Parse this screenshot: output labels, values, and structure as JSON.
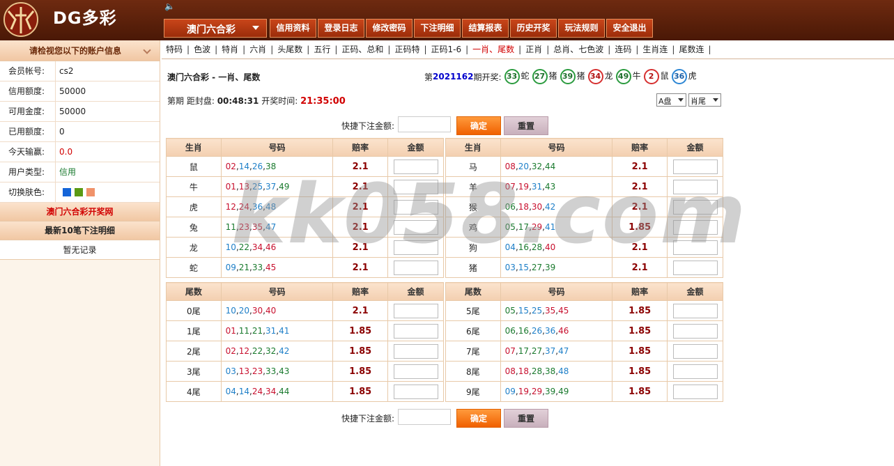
{
  "header": {
    "brand": "DG多彩",
    "game_select": "澳门六合彩",
    "nav": [
      "信用资料",
      "登录日志",
      "修改密码",
      "下注明细",
      "结算报表",
      "历史开奖",
      "玩法规则",
      "安全退出"
    ]
  },
  "sidebar": {
    "title": "请检视您以下的账户信息",
    "rows": [
      {
        "k": "会员帐号:",
        "v": "cs2"
      },
      {
        "k": "信用额度:",
        "v": "50000"
      },
      {
        "k": "可用金度:",
        "v": "50000"
      },
      {
        "k": "已用额度:",
        "v": "0"
      },
      {
        "k": "今天输赢:",
        "v": "0.0"
      },
      {
        "k": "用户类型:",
        "v": "信用"
      }
    ],
    "skin_label": "切换肤色:",
    "skin_colors": [
      "#1565d8",
      "#5b9a14",
      "#f0926a"
    ],
    "link1": "澳门六合彩开奖网",
    "link2": "最新10笔下注明细",
    "no_record": "暂无记录"
  },
  "subnav": [
    "特码",
    "色波",
    "特肖",
    "六肖",
    "头尾数",
    "五行",
    "正码、总和",
    "正码特",
    "正码1-6",
    "一肖、尾数",
    "正肖",
    "总肖、七色波",
    "连码",
    "生肖连",
    "尾数连"
  ],
  "subnav_active": "一肖、尾数",
  "main": {
    "title": "澳门六合彩 - 一肖、尾数",
    "draw_prefix": "第",
    "draw_period": "2021162",
    "draw_suffix": "期开奖:",
    "draw_balls": [
      {
        "n": "33",
        "z": "蛇",
        "c": "green"
      },
      {
        "n": "27",
        "z": "猪",
        "c": "green"
      },
      {
        "n": "39",
        "z": "猪",
        "c": "green"
      },
      {
        "n": "34",
        "z": "龙",
        "c": "red"
      },
      {
        "n": "49",
        "z": "牛",
        "c": "green"
      },
      {
        "n": "2",
        "z": "鼠",
        "c": "red"
      },
      {
        "n": "36",
        "z": "虎",
        "c": "blue"
      }
    ],
    "period_label": "第期 距封盘:",
    "countdown": "00:48:31",
    "open_label": "开奖时间:",
    "open_time": "21:35:00",
    "pan_select": "A盘",
    "type_select": "肖尾",
    "quick_label": "快捷下注金额:",
    "confirm": "确定",
    "reset": "重置"
  },
  "zodiac_headers": [
    "生肖",
    "号码",
    "赔率",
    "金额"
  ],
  "tail_headers": [
    "尾数",
    "号码",
    "赔率",
    "金额"
  ],
  "zodiac_left": [
    {
      "name": "鼠",
      "nums": [
        [
          "02",
          "r"
        ],
        [
          "14",
          "b"
        ],
        [
          "26",
          "b"
        ],
        [
          "38",
          "g"
        ]
      ],
      "odds": "2.1"
    },
    {
      "name": "牛",
      "nums": [
        [
          "01",
          "r"
        ],
        [
          "13",
          "r"
        ],
        [
          "25",
          "b"
        ],
        [
          "37",
          "b"
        ],
        [
          "49",
          "g"
        ]
      ],
      "odds": "2.1"
    },
    {
      "name": "虎",
      "nums": [
        [
          "12",
          "r"
        ],
        [
          "24",
          "r"
        ],
        [
          "36",
          "b"
        ],
        [
          "48",
          "b"
        ]
      ],
      "odds": "2.1"
    },
    {
      "name": "兔",
      "nums": [
        [
          "11",
          "g"
        ],
        [
          "23",
          "r"
        ],
        [
          "35",
          "r"
        ],
        [
          "47",
          "b"
        ]
      ],
      "odds": "2.1"
    },
    {
      "name": "龙",
      "nums": [
        [
          "10",
          "b"
        ],
        [
          "22",
          "g"
        ],
        [
          "34",
          "r"
        ],
        [
          "46",
          "r"
        ]
      ],
      "odds": "2.1"
    },
    {
      "name": "蛇",
      "nums": [
        [
          "09",
          "b"
        ],
        [
          "21",
          "g"
        ],
        [
          "33",
          "g"
        ],
        [
          "45",
          "r"
        ]
      ],
      "odds": "2.1"
    }
  ],
  "zodiac_right": [
    {
      "name": "马",
      "nums": [
        [
          "08",
          "r"
        ],
        [
          "20",
          "b"
        ],
        [
          "32",
          "g"
        ],
        [
          "44",
          "g"
        ]
      ],
      "odds": "2.1"
    },
    {
      "name": "羊",
      "nums": [
        [
          "07",
          "r"
        ],
        [
          "19",
          "r"
        ],
        [
          "31",
          "b"
        ],
        [
          "43",
          "g"
        ]
      ],
      "odds": "2.1"
    },
    {
      "name": "猴",
      "nums": [
        [
          "06",
          "g"
        ],
        [
          "18",
          "r"
        ],
        [
          "30",
          "r"
        ],
        [
          "42",
          "b"
        ]
      ],
      "odds": "2.1"
    },
    {
      "name": "鸡",
      "nums": [
        [
          "05",
          "g"
        ],
        [
          "17",
          "g"
        ],
        [
          "29",
          "r"
        ],
        [
          "41",
          "b"
        ]
      ],
      "odds": "1.85"
    },
    {
      "name": "狗",
      "nums": [
        [
          "04",
          "b"
        ],
        [
          "16",
          "g"
        ],
        [
          "28",
          "g"
        ],
        [
          "40",
          "r"
        ]
      ],
      "odds": "2.1"
    },
    {
      "name": "猪",
      "nums": [
        [
          "03",
          "b"
        ],
        [
          "15",
          "b"
        ],
        [
          "27",
          "g"
        ],
        [
          "39",
          "g"
        ]
      ],
      "odds": "2.1"
    }
  ],
  "tail_left": [
    {
      "name": "0尾",
      "nums": [
        [
          "10",
          "b"
        ],
        [
          "20",
          "b"
        ],
        [
          "30",
          "r"
        ],
        [
          "40",
          "r"
        ]
      ],
      "odds": "2.1"
    },
    {
      "name": "1尾",
      "nums": [
        [
          "01",
          "r"
        ],
        [
          "11",
          "g"
        ],
        [
          "21",
          "g"
        ],
        [
          "31",
          "b"
        ],
        [
          "41",
          "b"
        ]
      ],
      "odds": "1.85"
    },
    {
      "name": "2尾",
      "nums": [
        [
          "02",
          "r"
        ],
        [
          "12",
          "r"
        ],
        [
          "22",
          "g"
        ],
        [
          "32",
          "g"
        ],
        [
          "42",
          "b"
        ]
      ],
      "odds": "1.85"
    },
    {
      "name": "3尾",
      "nums": [
        [
          "03",
          "b"
        ],
        [
          "13",
          "r"
        ],
        [
          "23",
          "r"
        ],
        [
          "33",
          "g"
        ],
        [
          "43",
          "g"
        ]
      ],
      "odds": "1.85"
    },
    {
      "name": "4尾",
      "nums": [
        [
          "04",
          "b"
        ],
        [
          "14",
          "b"
        ],
        [
          "24",
          "r"
        ],
        [
          "34",
          "r"
        ],
        [
          "44",
          "g"
        ]
      ],
      "odds": "1.85"
    }
  ],
  "tail_right": [
    {
      "name": "5尾",
      "nums": [
        [
          "05",
          "g"
        ],
        [
          "15",
          "b"
        ],
        [
          "25",
          "b"
        ],
        [
          "35",
          "r"
        ],
        [
          "45",
          "r"
        ]
      ],
      "odds": "1.85"
    },
    {
      "name": "6尾",
      "nums": [
        [
          "06",
          "g"
        ],
        [
          "16",
          "g"
        ],
        [
          "26",
          "b"
        ],
        [
          "36",
          "b"
        ],
        [
          "46",
          "r"
        ]
      ],
      "odds": "1.85"
    },
    {
      "name": "7尾",
      "nums": [
        [
          "07",
          "r"
        ],
        [
          "17",
          "g"
        ],
        [
          "27",
          "g"
        ],
        [
          "37",
          "b"
        ],
        [
          "47",
          "b"
        ]
      ],
      "odds": "1.85"
    },
    {
      "name": "8尾",
      "nums": [
        [
          "08",
          "r"
        ],
        [
          "18",
          "r"
        ],
        [
          "28",
          "g"
        ],
        [
          "38",
          "g"
        ],
        [
          "48",
          "b"
        ]
      ],
      "odds": "1.85"
    },
    {
      "name": "9尾",
      "nums": [
        [
          "09",
          "b"
        ],
        [
          "19",
          "r"
        ],
        [
          "29",
          "r"
        ],
        [
          "39",
          "g"
        ],
        [
          "49",
          "g"
        ]
      ],
      "odds": "1.85"
    }
  ],
  "watermark": "kk058.com"
}
